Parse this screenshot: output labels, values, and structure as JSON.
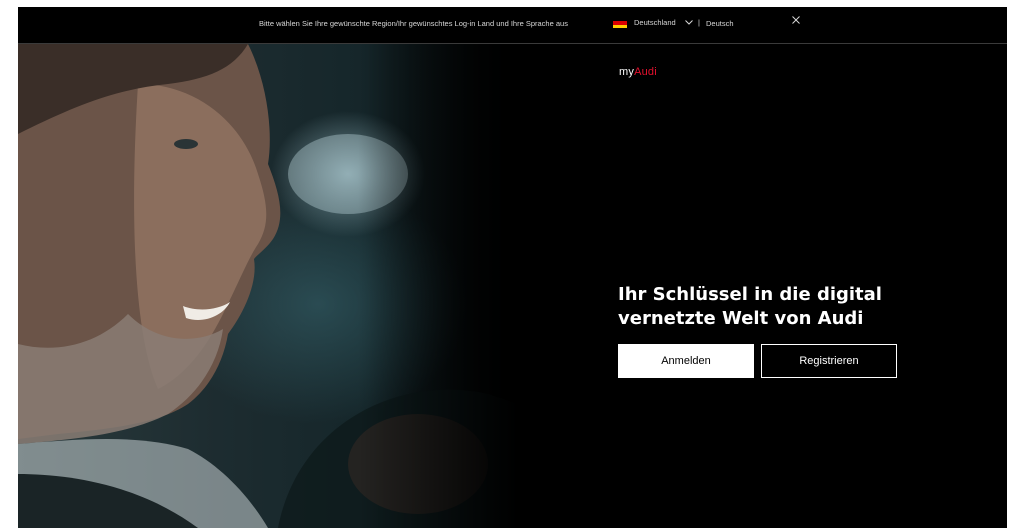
{
  "region_bar": {
    "prompt": "Bitte wählen Sie Ihre gewünschte Region/Ihr gewünschtes Log-in Land und Ihre Sprache aus",
    "country": "Deutschland",
    "separator": "|",
    "language": "Deutsch",
    "flag_colors": [
      "#000000",
      "#dd0000",
      "#ffce00"
    ]
  },
  "brand": {
    "prefix": "my",
    "name": "Audi",
    "accent_color": "#e4112e"
  },
  "hero": {
    "headline": "Ihr Schlüssel in die digital vernetzte Welt von Audi"
  },
  "actions": {
    "login_label": "Anmelden",
    "register_label": "Registrieren"
  }
}
